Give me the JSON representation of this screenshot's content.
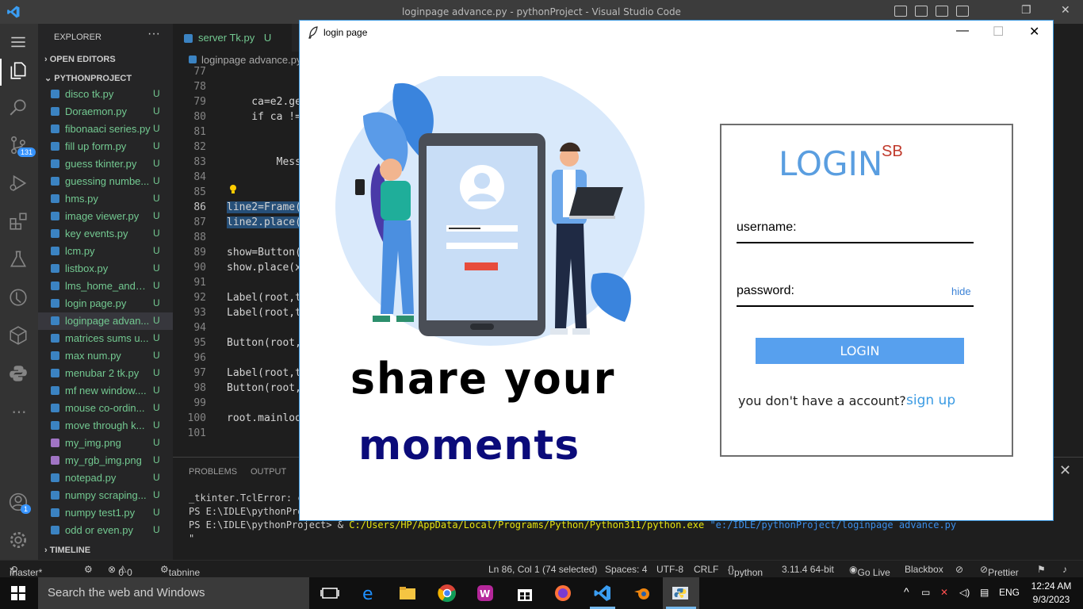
{
  "vscode": {
    "window_title": "loginpage advance.py - pythonProject - Visual Studio Code",
    "explorer_title": "EXPLORER",
    "more": "···",
    "open_editors": "OPEN EDITORS",
    "project": "PYTHONPROJECT",
    "timeline": "TIMELINE",
    "source_control_badge": "131",
    "accounts_badge": "1",
    "files": [
      {
        "name": "disco tk.py",
        "status": "U",
        "icon": "python"
      },
      {
        "name": "Doraemon.py",
        "status": "U",
        "icon": "python"
      },
      {
        "name": "fibonaaci series.py",
        "status": "U",
        "icon": "python"
      },
      {
        "name": "fill up form.py",
        "status": "U",
        "icon": "python"
      },
      {
        "name": "guess tkinter.py",
        "status": "U",
        "icon": "python"
      },
      {
        "name": "guessing numbe...",
        "status": "U",
        "icon": "python"
      },
      {
        "name": "hms.py",
        "status": "U",
        "icon": "python"
      },
      {
        "name": "image viewer.py",
        "status": "U",
        "icon": "python"
      },
      {
        "name": "key events.py",
        "status": "U",
        "icon": "python"
      },
      {
        "name": "lcm.py",
        "status": "U",
        "icon": "python"
      },
      {
        "name": "listbox.py",
        "status": "U",
        "icon": "python"
      },
      {
        "name": "lms_home_and_l...",
        "status": "U",
        "icon": "python"
      },
      {
        "name": "login page.py",
        "status": "U",
        "icon": "python"
      },
      {
        "name": "loginpage advan...",
        "status": "U",
        "icon": "python"
      },
      {
        "name": "matrices sums u...",
        "status": "U",
        "icon": "python"
      },
      {
        "name": "max num.py",
        "status": "U",
        "icon": "python"
      },
      {
        "name": "menubar 2 tk.py",
        "status": "U",
        "icon": "python"
      },
      {
        "name": "mf new window....",
        "status": "U",
        "icon": "python"
      },
      {
        "name": "mouse co-ordin...",
        "status": "U",
        "icon": "python"
      },
      {
        "name": "move through k...",
        "status": "U",
        "icon": "python"
      },
      {
        "name": "my_img.png",
        "status": "U",
        "icon": "image"
      },
      {
        "name": "my_rgb_img.png",
        "status": "U",
        "icon": "image"
      },
      {
        "name": "notepad.py",
        "status": "U",
        "icon": "python"
      },
      {
        "name": "numpy scraping...",
        "status": "U",
        "icon": "python"
      },
      {
        "name": "numpy test1.py",
        "status": "U",
        "icon": "python"
      },
      {
        "name": "odd or even.py",
        "status": "U",
        "icon": "python"
      }
    ],
    "tabs": [
      {
        "label": "server Tk.py",
        "status": "U"
      }
    ],
    "breadcrumb": "loginpage advance.py",
    "code_lines": [
      {
        "num": "77",
        "code": ""
      },
      {
        "num": "78",
        "code": ""
      },
      {
        "num": "79",
        "code": "    ca=e2.ge"
      },
      {
        "num": "80",
        "code": "    if ca !="
      },
      {
        "num": "81",
        "code": ""
      },
      {
        "num": "82",
        "code": ""
      },
      {
        "num": "83",
        "code": "        Mess"
      },
      {
        "num": "84",
        "code": ""
      },
      {
        "num": "85",
        "code": ""
      },
      {
        "num": "86",
        "code": "line2=Frame("
      },
      {
        "num": "87",
        "code": "line2.place("
      },
      {
        "num": "88",
        "code": ""
      },
      {
        "num": "89",
        "code": "show=Button("
      },
      {
        "num": "90",
        "code": "show.place(x"
      },
      {
        "num": "91",
        "code": ""
      },
      {
        "num": "92",
        "code": "Label(root,t"
      },
      {
        "num": "93",
        "code": "Label(root,t"
      },
      {
        "num": "94",
        "code": ""
      },
      {
        "num": "95",
        "code": "Button(root,"
      },
      {
        "num": "96",
        "code": ""
      },
      {
        "num": "97",
        "code": "Label(root,t"
      },
      {
        "num": "98",
        "code": "Button(root,"
      },
      {
        "num": "99",
        "code": ""
      },
      {
        "num": "100",
        "code": "root.mainloo"
      },
      {
        "num": "101",
        "code": ""
      }
    ],
    "panel_tabs": [
      "PROBLEMS",
      "OUTPUT"
    ],
    "terminal": {
      "line1": "_tkinter.TclError: c",
      "line2": "PS E:\\IDLE\\pythonPro",
      "line3_prompt": "PS E:\\IDLE\\pythonProject> & ",
      "line3_exe": "C:/Users/HP/AppData/Local/Programs/Python/Python311/python.exe",
      "line3_arg": " \"e:/IDLE/pythonProject/loginpage advance.py",
      "line4": "\""
    },
    "status": {
      "branch": "master*",
      "errors": "0",
      "warnings": "0",
      "tabnine": "tabnine",
      "position": "Ln 86, Col 1 (74 selected)",
      "spaces": "Spaces: 4",
      "encoding": "UTF-8",
      "eol": "CRLF",
      "language": "python",
      "interpreter": "3.11.4 64-bit",
      "golive": "Go Live",
      "blackbox": "Blackbox",
      "prettier": "Prettier"
    }
  },
  "taskbar": {
    "search_placeholder": "Search the web and Windows",
    "lang": "ENG",
    "time": "12:24 AM",
    "date": "9/3/2023"
  },
  "tk": {
    "title": "login page",
    "slogan_line1": "share your",
    "slogan_line2": "moments",
    "login_title": "LOGIN",
    "login_super": "SB",
    "username_label": "username:",
    "password_label": "password:",
    "hide_label": "hide",
    "login_button": "LOGIN",
    "no_account": "you don't have a account?",
    "signup": "sign up",
    "colors": {
      "accent": "#57a0ee",
      "title": "#5a9ee0",
      "super": "#c0392b",
      "slogan2": "#0b0b7a"
    }
  }
}
